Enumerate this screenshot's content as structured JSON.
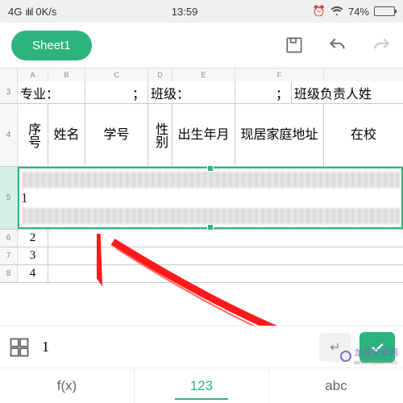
{
  "status": {
    "network": "4G",
    "signal": "ılıl",
    "speed": "0K/s",
    "time": "13:59",
    "battery_pct": "74%"
  },
  "toolbar": {
    "sheet_name": "Sheet1"
  },
  "columns": [
    "A",
    "B",
    "C",
    "D",
    "E",
    "F"
  ],
  "row_nums": {
    "r3": "3",
    "r4": "4",
    "r5": "5",
    "r6": "6",
    "r7": "7",
    "r8": "8"
  },
  "labels_row": {
    "major": "专业：",
    "sep1": "；",
    "class": "班级：",
    "sep2": "；",
    "leader": "班级负责人姓"
  },
  "header2": {
    "c1": "序号",
    "c2": "姓名",
    "c3": "学号",
    "c4": "性别",
    "c5": "出生年月",
    "c6": "现居家庭地址",
    "c7": "在校"
  },
  "data_rows": {
    "r5": "1",
    "r6": "2",
    "r7": "3",
    "r8": "4"
  },
  "formula_bar": {
    "value": "1"
  },
  "kbd": {
    "t1": "f(x)",
    "t2": "123",
    "t3": "abc"
  },
  "watermark": {
    "text": "龙城安卓网",
    "url": "www.lcjcw.com"
  }
}
